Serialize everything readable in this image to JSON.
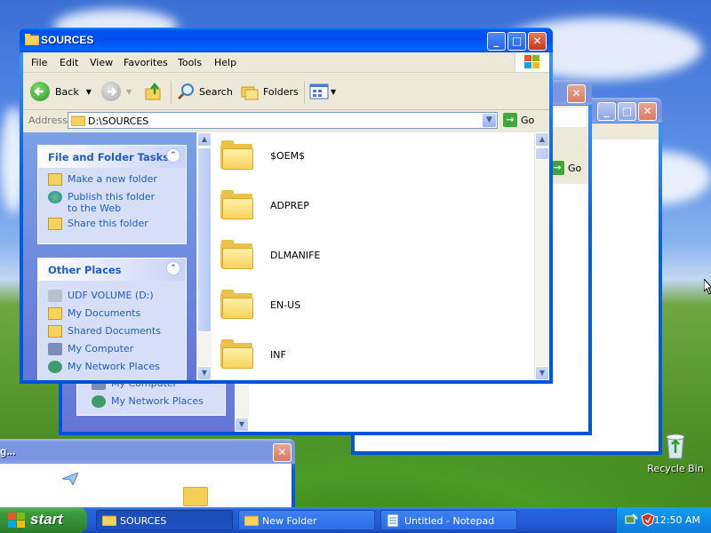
{
  "main_window": {
    "title": "SOURCES",
    "menu": [
      "File",
      "Edit",
      "View",
      "Favorites",
      "Tools",
      "Help"
    ],
    "toolbar": {
      "back": "Back",
      "search": "Search",
      "folders": "Folders"
    },
    "address": {
      "label": "Address",
      "value": "D:\\SOURCES",
      "go": "Go"
    },
    "tasks_panel": {
      "title": "File and Folder Tasks",
      "items": [
        "Make a new folder",
        "Publish this folder to the Web",
        "Share this folder"
      ]
    },
    "places_panel": {
      "title": "Other Places",
      "items": [
        "UDF VOLUME (D:)",
        "My Documents",
        "Shared Documents",
        "My Computer",
        "My Network Places"
      ]
    },
    "folders": [
      "$OEM$",
      "ADPREP",
      "DLMANIFE",
      "EN-US",
      "INF"
    ]
  },
  "behind_window": {
    "go": "Go",
    "places": [
      "My Computer",
      "My Network Places"
    ]
  },
  "bottom_window": {
    "title": "g..."
  },
  "desktop": {
    "recycle_bin": "Recycle Bin"
  },
  "taskbar": {
    "start": "start",
    "buttons": [
      "SOURCES",
      "New Folder",
      "Untitled - Notepad"
    ],
    "clock": "12:50 AM"
  },
  "colors": {
    "titlebar": "#0054e3",
    "taskbar": "#245edb",
    "start": "#3c9c3c",
    "link": "#215dc6"
  }
}
